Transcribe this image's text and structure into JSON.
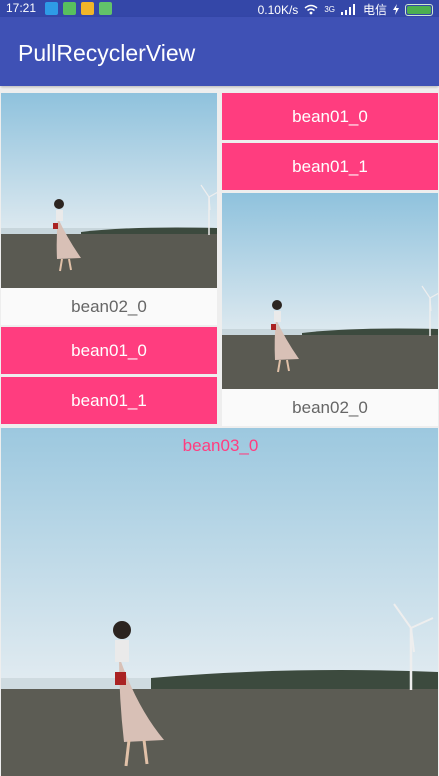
{
  "status_bar": {
    "time": "17:21",
    "speed": "0.10K/s",
    "carrier": "电信",
    "network": "3G"
  },
  "app": {
    "title": "PullRecyclerView"
  },
  "colors": {
    "appbar": "#3f51b5",
    "statusbar": "#3447a8",
    "accent": "#ff3d7f"
  },
  "items": {
    "left_caption": "bean02_0",
    "left_btn_0": "bean01_0",
    "left_btn_1": "bean01_1",
    "right_btn_0": "bean01_0",
    "right_btn_1": "bean01_1",
    "right_caption": "bean02_0",
    "big_label": "bean03_0"
  },
  "icons": [
    "usb-icon",
    "clipboard-icon",
    "weibo-icon",
    "android-icon",
    "wifi-icon",
    "signal-icon",
    "charging-icon",
    "battery-icon"
  ]
}
